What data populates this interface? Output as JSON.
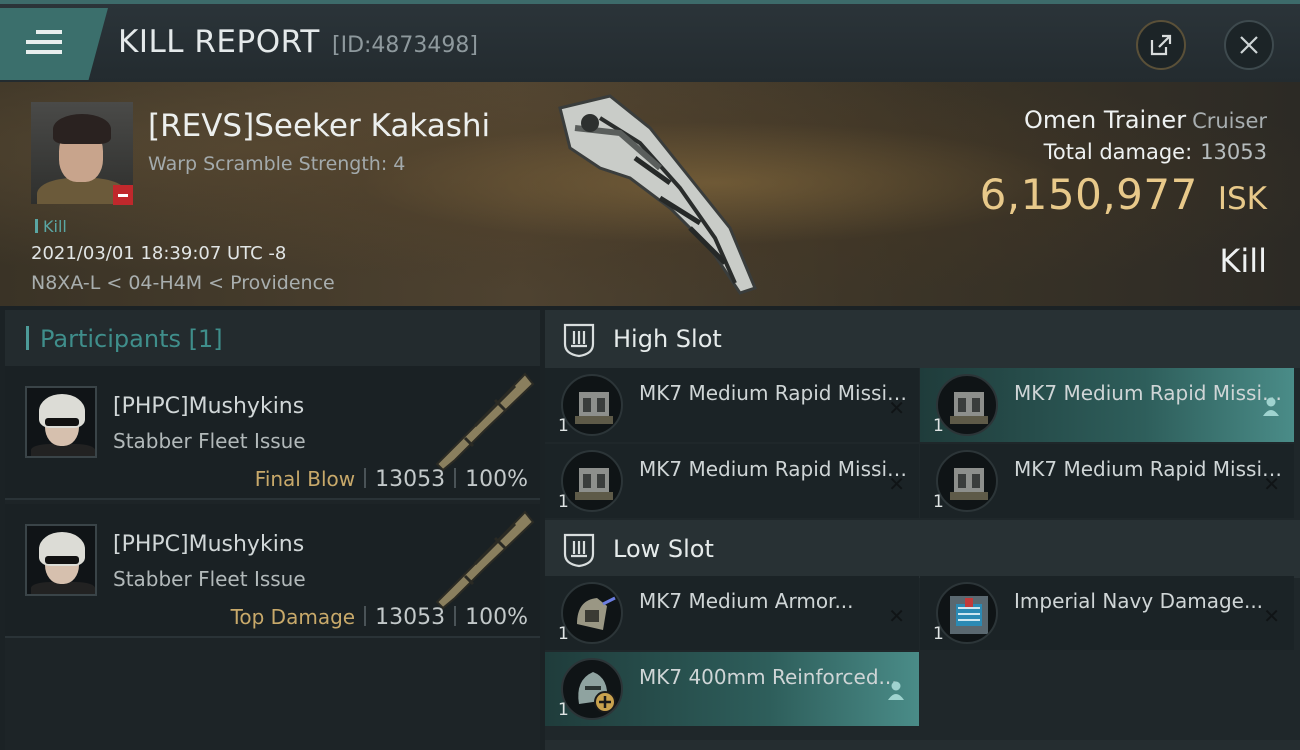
{
  "header": {
    "title": "KILL REPORT",
    "report_id": "[ID:4873498]"
  },
  "victim": {
    "name": "[REVS]Seeker Kakashi",
    "warp_scramble": "Warp Scramble Strength: 4",
    "tag": "Kill",
    "timestamp": "2021/03/01 18:39:07 UTC -8",
    "location": "N8XA-L < 04-H4M < Providence"
  },
  "ship": {
    "name": "Omen Trainer",
    "class": "Cruiser",
    "total_damage_label": "Total damage:",
    "total_damage_value": "13053",
    "isk_value": "6,150,977",
    "isk_unit": "ISK",
    "result": "Kill"
  },
  "participants": {
    "title": "Participants [1]",
    "items": [
      {
        "name": "[PHPC]Mushykins",
        "ship": "Stabber Fleet Issue",
        "role": "Final Blow",
        "damage": "13053",
        "percent": "100%"
      },
      {
        "name": "[PHPC]Mushykins",
        "ship": "Stabber Fleet Issue",
        "role": "Top Damage",
        "damage": "13053",
        "percent": "100%"
      }
    ]
  },
  "high_slot": {
    "title": "High Slot",
    "modules": [
      {
        "name": "MK7 Medium Rapid Missile...",
        "qty": "1",
        "status": "destroyed"
      },
      {
        "name": "MK7 Medium Rapid Missile...",
        "qty": "1",
        "status": "dropped"
      },
      {
        "name": "MK7 Medium Rapid Missile...",
        "qty": "1",
        "status": "destroyed"
      },
      {
        "name": "MK7 Medium Rapid Missile...",
        "qty": "1",
        "status": "destroyed"
      }
    ]
  },
  "low_slot": {
    "title": "Low Slot",
    "modules": [
      {
        "name": "MK7 Medium Armor...",
        "qty": "1",
        "status": "destroyed"
      },
      {
        "name": "Imperial Navy Damage...",
        "qty": "1",
        "status": "destroyed"
      },
      {
        "name": "MK7 400mm Reinforced...",
        "qty": "1",
        "status": "dropped"
      }
    ]
  },
  "colors": {
    "accent_teal": "#3f8e8b",
    "isk_gold": "#e8c98a",
    "role_gold": "#c8a96a",
    "dropped_highlight": "#4a8c88"
  }
}
